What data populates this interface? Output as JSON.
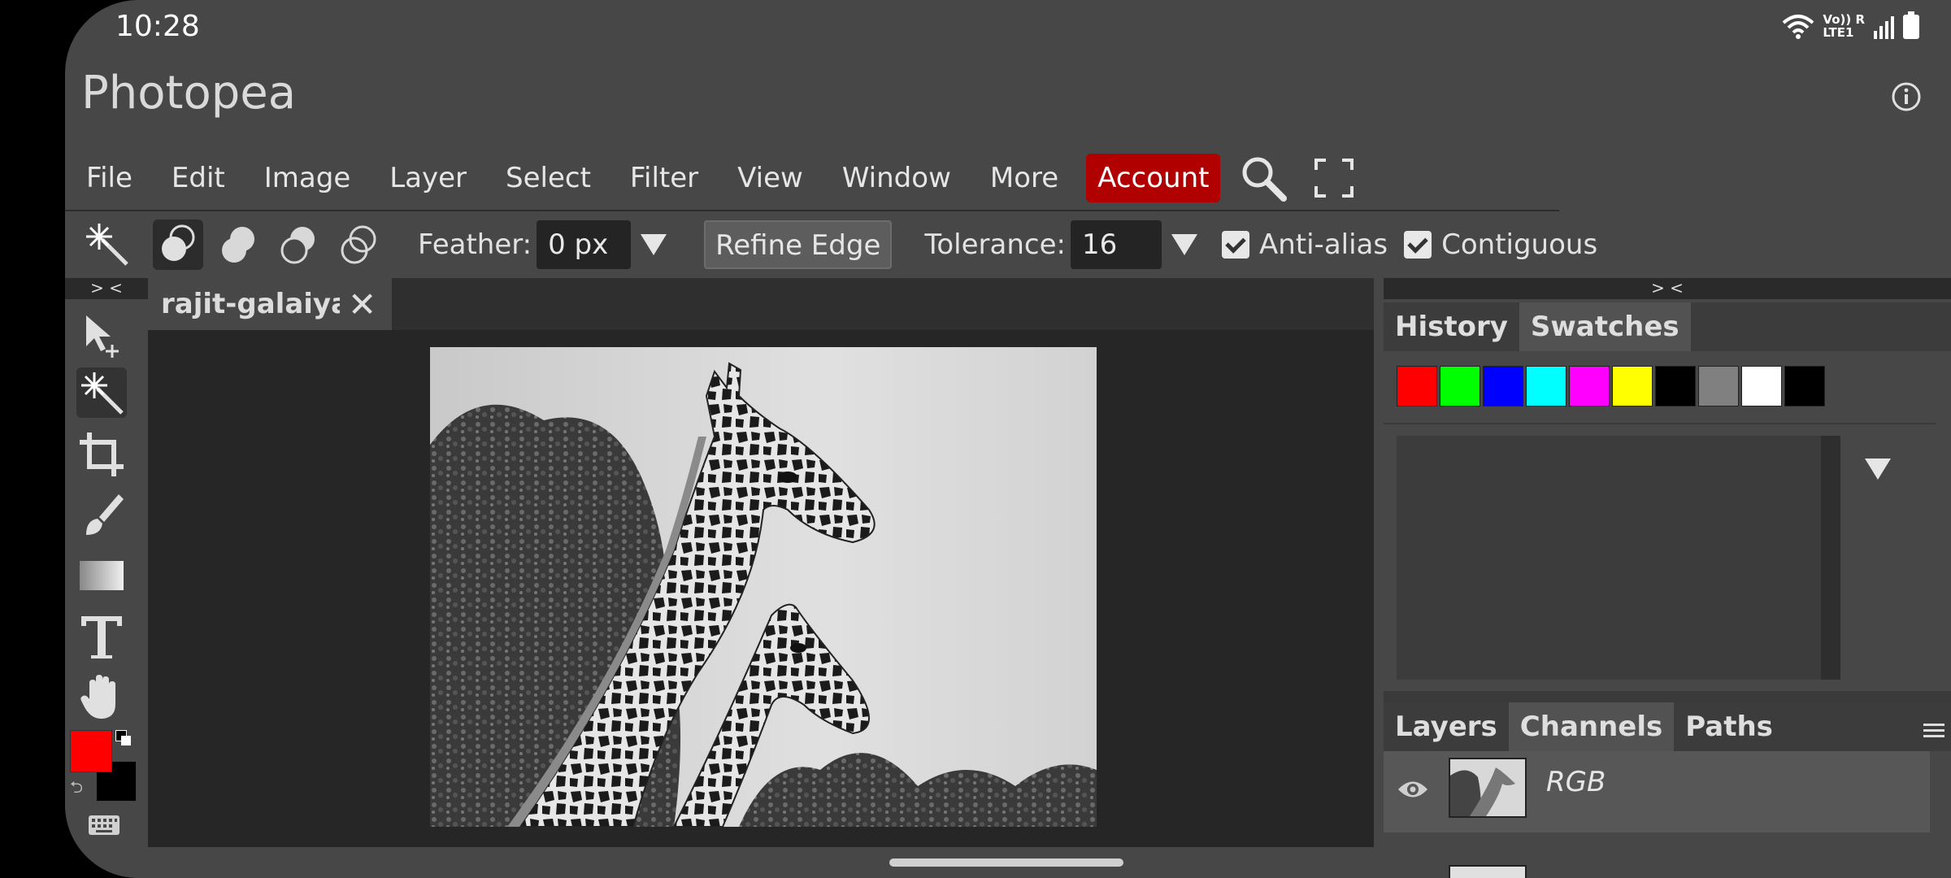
{
  "status": {
    "time": "10:28",
    "network_label_top": "Vo)) R",
    "network_label_bottom": "LTE1"
  },
  "app": {
    "title": "Photopea"
  },
  "menu": {
    "items": [
      "File",
      "Edit",
      "Image",
      "Layer",
      "Select",
      "Filter",
      "View",
      "Window",
      "More"
    ],
    "account_label": "Account",
    "account_color": "#b00000"
  },
  "options": {
    "feather_label": "Feather:",
    "feather_value": "0 px",
    "refine_edge_label": "Refine Edge",
    "tolerance_label": "Tolerance:",
    "tolerance_value": "16",
    "antialias_label": "Anti-alias",
    "antialias_checked": true,
    "contiguous_label": "Contiguous",
    "contiguous_checked": true
  },
  "toolbar": {
    "collapse_label": "> <",
    "tools": [
      "move-tool-icon",
      "magic-wand-tool-icon",
      "crop-tool-icon",
      "brush-tool-icon",
      "gradient-tool-icon",
      "type-tool-icon",
      "hand-tool-icon"
    ],
    "foreground_color": "#ff0000",
    "background_color": "#000000"
  },
  "document": {
    "tab_name": "rajit-galaiya-",
    "close_glyph": "✕"
  },
  "right_panel": {
    "collapse_label": "> <",
    "top_tabs": [
      "History",
      "Swatches"
    ],
    "swatches": [
      "#ff0000",
      "#00ff00",
      "#0000ff",
      "#00ffff",
      "#ff00ff",
      "#ffff00",
      "#000000",
      "#808080",
      "#ffffff",
      "#000000"
    ],
    "bottom_tabs": [
      "Layers",
      "Channels",
      "Paths"
    ],
    "channel_name": "RGB"
  }
}
